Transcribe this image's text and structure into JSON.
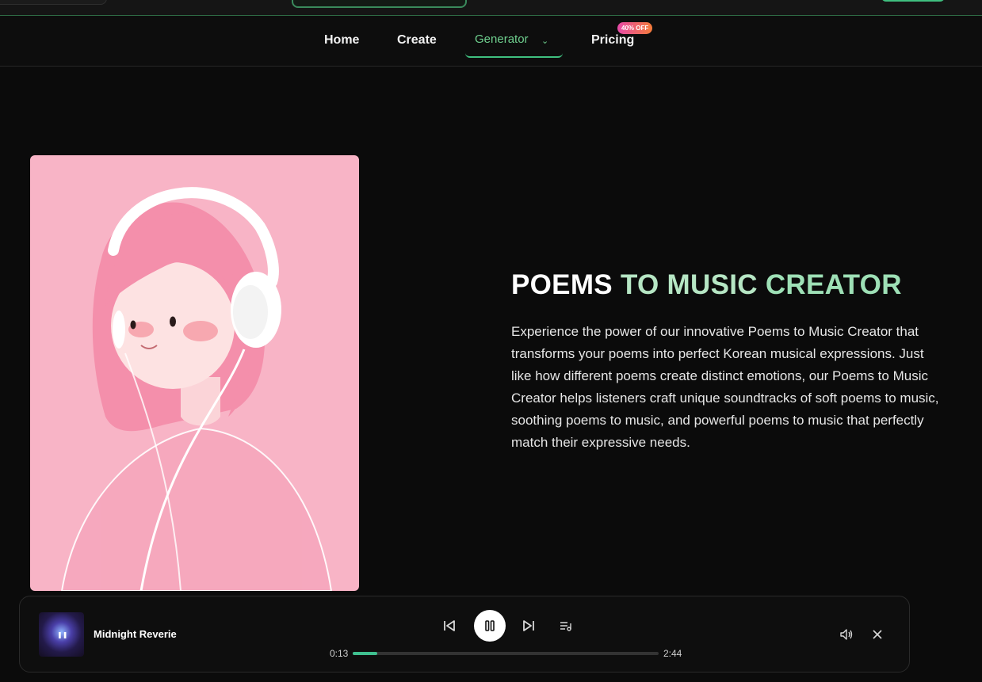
{
  "nav": {
    "items": [
      {
        "label": "Home"
      },
      {
        "label": "Create"
      },
      {
        "label": "Generator"
      },
      {
        "label": "Pricing"
      }
    ],
    "pricing_badge": "40% OFF"
  },
  "hero": {
    "title_part1": "POEMS",
    "title_part2": "TO MUSIC",
    "title_part3": "CREATOR",
    "description": "Experience the power of our innovative Poems to Music Creator that transforms your poems into perfect Korean musical expressions. Just like how different poems create distinct emotions, our Poems to Music Creator helps listeners craft unique soundtracks of soft poems to music, soothing poems to music, and powerful poems to music that perfectly match their expressive needs."
  },
  "player": {
    "song_title": "Midnight Reverie",
    "current_time": "0:13",
    "total_time": "2:44",
    "progress": 0.08
  },
  "colors": {
    "accent": "#3fbf7f",
    "title_green": "#9ee0b6",
    "image_bg": "#f8b4c6"
  }
}
